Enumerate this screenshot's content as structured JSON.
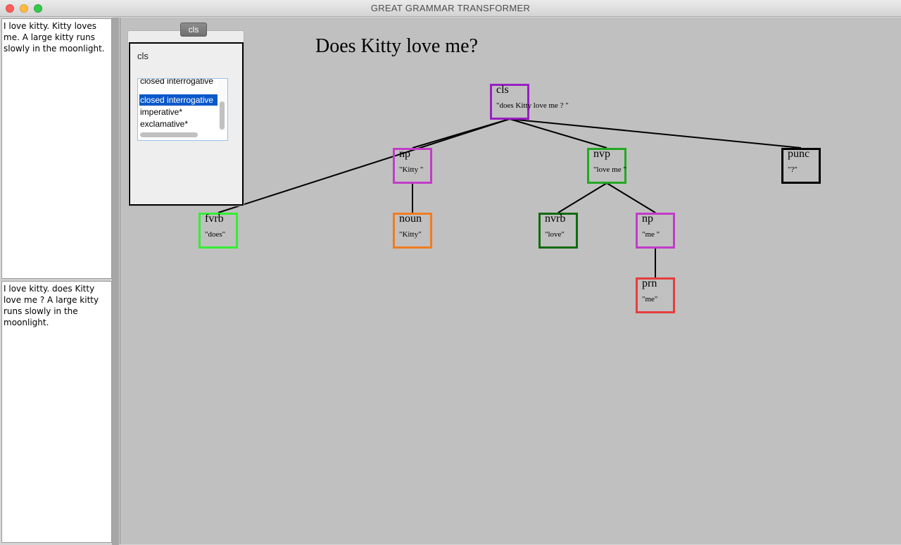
{
  "window": {
    "title": "GREAT GRAMMAR TRANSFORMER"
  },
  "input_text": "I love kitty. Kitty loves me. A large kitty runs slowly in the moonlight.",
  "output_text": "I love kitty. does Kitty love me ? A large kitty runs slowly in the moonlight.",
  "sentence_heading": "Does Kitty love me?",
  "panel": {
    "tab_label": "cls",
    "title": "cls",
    "options": [
      "closed interrogative",
      "closed interrogative",
      "imperative*",
      "exclamative*"
    ],
    "selected_index": 1
  },
  "tree": {
    "nodes": [
      {
        "id": "cls",
        "label": "cls",
        "text": "\"does Kitty love me ? \"",
        "color": "#9a1fc4",
        "parent": null
      },
      {
        "id": "fvrb",
        "label": "fvrb",
        "text": "\"does\"",
        "color": "#33ee33",
        "parent": "cls"
      },
      {
        "id": "np1",
        "label": "np",
        "text": "\"Kitty \"",
        "color": "#c23bc8",
        "parent": "cls"
      },
      {
        "id": "nvp",
        "label": "nvp",
        "text": "\"love me \"",
        "color": "#23a823",
        "parent": "cls"
      },
      {
        "id": "punc",
        "label": "punc",
        "text": "\"?\"",
        "color": "#000000",
        "parent": "cls"
      },
      {
        "id": "noun",
        "label": "noun",
        "text": "\"Kitty\"",
        "color": "#f07c1e",
        "parent": "np1"
      },
      {
        "id": "nvrb",
        "label": "nvrb",
        "text": "\"love\"",
        "color": "#0f6b0f",
        "parent": "nvp"
      },
      {
        "id": "np2",
        "label": "np",
        "text": "\"me \"",
        "color": "#c23bc8",
        "parent": "nvp"
      },
      {
        "id": "prn",
        "label": "prn",
        "text": "\"me\"",
        "color": "#e83c3c",
        "parent": "np2"
      }
    ]
  }
}
